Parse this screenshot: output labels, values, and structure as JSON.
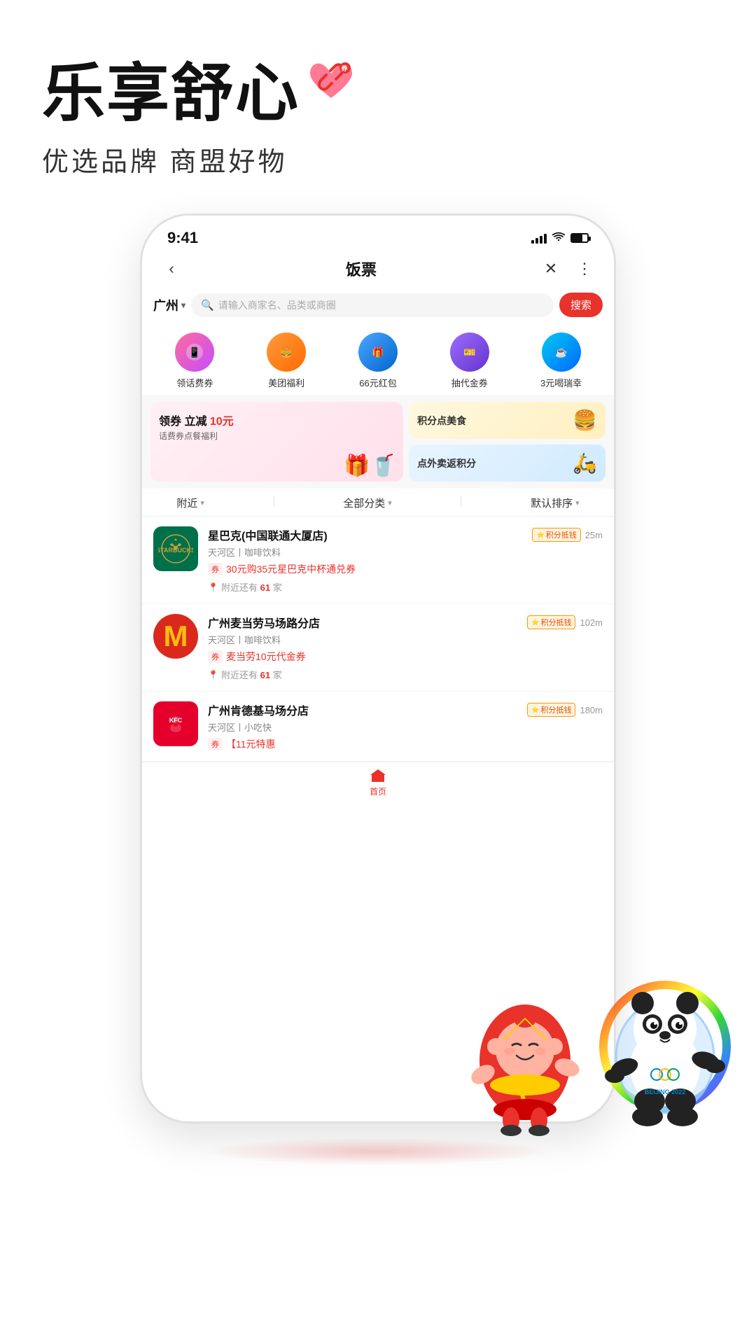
{
  "app": {
    "title": "乐享舒心",
    "subtitle": "优选品牌 商盟好物",
    "logo_text": "🎀"
  },
  "phone": {
    "status_bar": {
      "time": "9:41"
    },
    "nav": {
      "title": "饭票",
      "back_icon": "‹",
      "close_icon": "✕",
      "more_icon": "⋮"
    },
    "search": {
      "city": "广州",
      "placeholder": "请输入商家名、品类或商圈",
      "btn_label": "搜索"
    },
    "quick_icons": [
      {
        "label": "领话费券",
        "emoji": "📱",
        "color_class": "qi-pink"
      },
      {
        "label": "美团福利",
        "emoji": "🍔",
        "color_class": "qi-orange"
      },
      {
        "label": "66元红包",
        "emoji": "📦",
        "color_class": "qi-blue"
      },
      {
        "label": "抽代金券",
        "emoji": "🎁",
        "color_class": "qi-purple"
      },
      {
        "label": "3元喝瑞幸",
        "emoji": "☕",
        "color_class": "qi-cyan"
      }
    ],
    "banner": {
      "left": {
        "title": "领券 立减",
        "highlight": "10元",
        "subtitle": "话费券点餐福利"
      },
      "right_top": {
        "title": "积分点美食"
      },
      "right_bottom": {
        "title": "点外卖返积分"
      }
    },
    "filters": [
      {
        "label": "附近"
      },
      {
        "label": "全部分类"
      },
      {
        "label": "默认排序"
      }
    ],
    "stores": [
      {
        "name": "星巴克(中国联通大厦店)",
        "badge": "积分抵钱",
        "distance": "25m",
        "category": "天河区丨咖啡饮料",
        "coupon": "30元购35元星巴克中杯通兑券",
        "nearby": "附近还有",
        "nearby_count": "61",
        "nearby_unit": "家",
        "type": "starbucks"
      },
      {
        "name": "广州麦当劳马场路分店",
        "badge": "积分抵钱",
        "distance": "102m",
        "category": "天河区丨咖啡饮料",
        "coupon": "麦当劳10元代金券",
        "nearby": "附近还有",
        "nearby_count": "61",
        "nearby_unit": "家",
        "type": "mcd"
      },
      {
        "name": "广州肯德基马场分店",
        "badge": "积分抵钱",
        "distance": "180m",
        "category": "天河区丨小吃快",
        "coupon": "【11元特惠",
        "nearby": "",
        "nearby_count": "",
        "nearby_unit": "",
        "type": "kfc"
      }
    ],
    "bottom_nav": [
      {
        "label": "首页",
        "active": true
      }
    ]
  }
}
